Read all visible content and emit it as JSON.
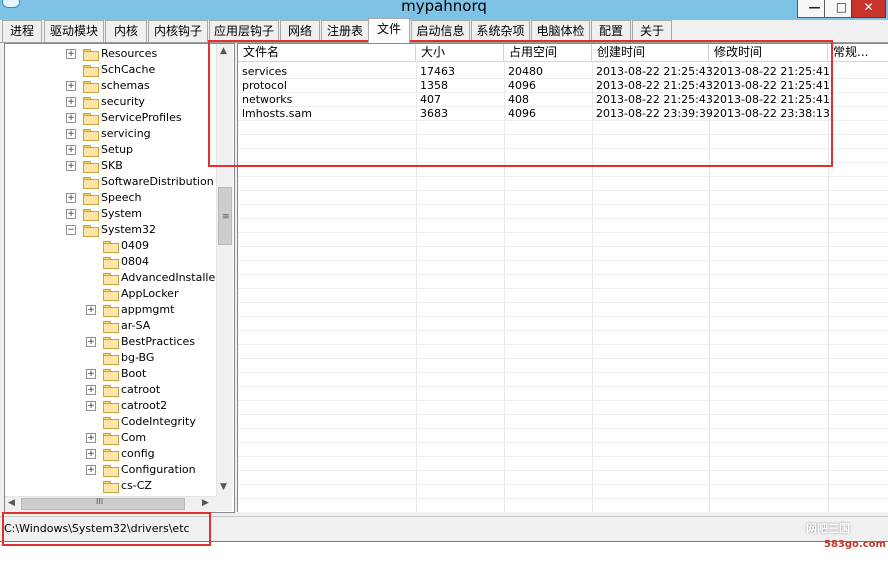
{
  "window": {
    "title": "mypahnorq",
    "buttons": {
      "minimize": "—",
      "maximize": "□",
      "close": "✕"
    }
  },
  "tabs": [
    {
      "label": "进程"
    },
    {
      "label": "驱动模块"
    },
    {
      "label": "内核"
    },
    {
      "label": "内核钩子"
    },
    {
      "label": "应用层钩子"
    },
    {
      "label": "网络"
    },
    {
      "label": "注册表"
    },
    {
      "label": "文件",
      "active": true
    },
    {
      "label": "启动信息"
    },
    {
      "label": "系统杂项"
    },
    {
      "label": "电脑体检"
    },
    {
      "label": "配置"
    },
    {
      "label": "关于"
    }
  ],
  "tree": {
    "items": [
      {
        "label": "Resources",
        "level": 0,
        "expander": "+"
      },
      {
        "label": "SchCache",
        "level": 0,
        "expander": ""
      },
      {
        "label": "schemas",
        "level": 0,
        "expander": "+"
      },
      {
        "label": "security",
        "level": 0,
        "expander": "+"
      },
      {
        "label": "ServiceProfiles",
        "level": 0,
        "expander": "+"
      },
      {
        "label": "servicing",
        "level": 0,
        "expander": "+"
      },
      {
        "label": "Setup",
        "level": 0,
        "expander": "+"
      },
      {
        "label": "SKB",
        "level": 0,
        "expander": "+"
      },
      {
        "label": "SoftwareDistribution",
        "level": 0,
        "expander": ""
      },
      {
        "label": "Speech",
        "level": 0,
        "expander": "+"
      },
      {
        "label": "System",
        "level": 0,
        "expander": "+"
      },
      {
        "label": "System32",
        "level": 0,
        "expander": "−"
      },
      {
        "label": "0409",
        "level": 1,
        "expander": ""
      },
      {
        "label": "0804",
        "level": 1,
        "expander": ""
      },
      {
        "label": "AdvancedInstallers",
        "level": 1,
        "expander": ""
      },
      {
        "label": "AppLocker",
        "level": 1,
        "expander": ""
      },
      {
        "label": "appmgmt",
        "level": 1,
        "expander": "+"
      },
      {
        "label": "ar-SA",
        "level": 1,
        "expander": ""
      },
      {
        "label": "BestPractices",
        "level": 1,
        "expander": "+"
      },
      {
        "label": "bg-BG",
        "level": 1,
        "expander": ""
      },
      {
        "label": "Boot",
        "level": 1,
        "expander": "+"
      },
      {
        "label": "catroot",
        "level": 1,
        "expander": "+"
      },
      {
        "label": "catroot2",
        "level": 1,
        "expander": "+"
      },
      {
        "label": "CodeIntegrity",
        "level": 1,
        "expander": ""
      },
      {
        "label": "Com",
        "level": 1,
        "expander": "+"
      },
      {
        "label": "config",
        "level": 1,
        "expander": "+"
      },
      {
        "label": "Configuration",
        "level": 1,
        "expander": "+"
      },
      {
        "label": "cs-CZ",
        "level": 1,
        "expander": ""
      }
    ],
    "scroll": {
      "up": "▲",
      "down": "▼",
      "left": "◀",
      "right": "▶",
      "grip": "≡",
      "hgrip": "III"
    }
  },
  "filelist": {
    "columns": [
      "文件名",
      "大小",
      "占用空间",
      "创建时间",
      "修改时间",
      "常规..."
    ],
    "rows": [
      [
        "services",
        "17463",
        "20480",
        "2013-08-22 21:25:43",
        "2013-08-22 21:25:41",
        ""
      ],
      [
        "protocol",
        "1358",
        "4096",
        "2013-08-22 21:25:43",
        "2013-08-22 21:25:41",
        ""
      ],
      [
        "networks",
        "407",
        "408",
        "2013-08-22 21:25:43",
        "2013-08-22 21:25:41",
        ""
      ],
      [
        "lmhosts.sam",
        "3683",
        "4096",
        "2013-08-22 23:39:39",
        "2013-08-22 23:38:13",
        ""
      ]
    ]
  },
  "status": {
    "path": "C:\\Windows\\System32\\drivers\\etc"
  },
  "watermark": {
    "line1": "网吧三国",
    "line2": "583go.com"
  },
  "colors": {
    "annotation": "#e03131",
    "titlebar": "#7ec3e6",
    "folder": "#fbe7a6"
  }
}
